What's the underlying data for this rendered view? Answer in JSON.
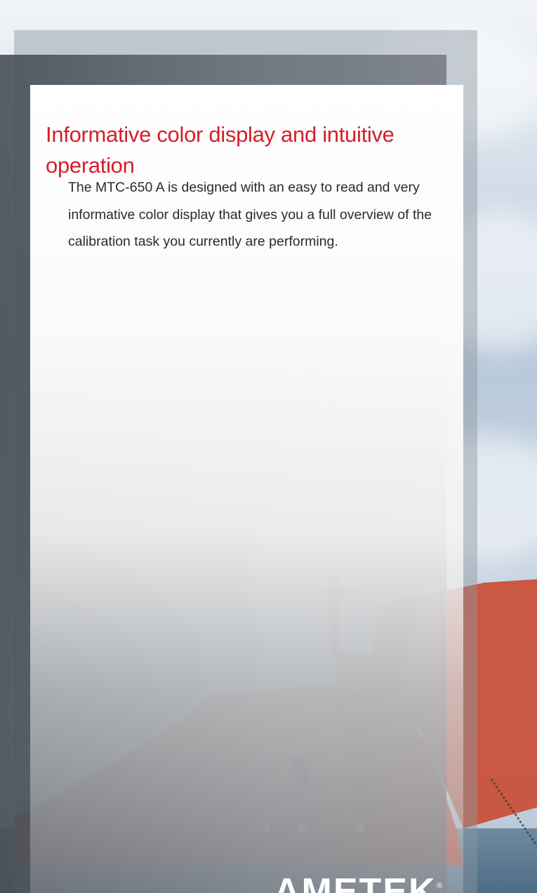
{
  "brochure": {
    "headline": "Informative color display and intuitive operation",
    "body": "The MTC-650 A is designed with an easy to read and very informative color display that gives you a full overview of the calibration task you currently are performing."
  },
  "footer": {
    "logo_text": "AMETEK",
    "registered_mark": "®"
  },
  "colors": {
    "headline": "#d51f2c",
    "body_text": "#2b2b2b",
    "ship_hull": "#d4573d"
  },
  "background_image": {
    "subject": "red tanker ship bow at sea under a cloudy sky"
  }
}
